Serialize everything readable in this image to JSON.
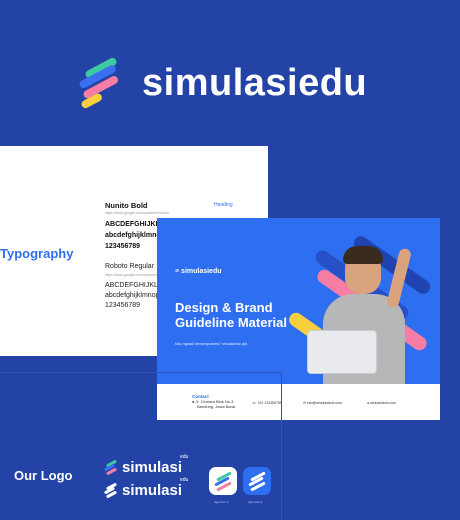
{
  "brand": {
    "name": "simulasiedu",
    "colors": {
      "background": "#2443a6",
      "primary": "#2d6ff0",
      "green": "#3fc9a0",
      "blue": "#3a6ff2",
      "pink": "#f77da4",
      "yellow": "#f7cf3e"
    }
  },
  "typography": {
    "section_title": "Typography",
    "tag": "Heading",
    "font1_name": "Nunito Bold",
    "font1_url": "https://fonts.google.com/specimen/Nunito",
    "font1_upper": "ABCDEFGHIJKLMNOPQRSTUVWXYZ",
    "font1_lower": "abcdefghijklmnopqrstuvwxyz",
    "font1_digits": "123456789",
    "font2_name": "Roboto Regular",
    "font2_url": "https://fonts.google.com/specimen/Roboto",
    "font2_upper": "ABCDEFGHIJKLMNOPQRSTUVWXYZ",
    "font2_lower": "abcdefghijklmnopqrstuvwxyz",
    "font2_digits": "123456789"
  },
  "guideline": {
    "logo_text": "simulasiedu",
    "title_line1": "Design & Brand",
    "title_line2": "Guideline Material",
    "subtitle": "Mau ngasah kemampuanmu? simulasiedu aja!",
    "contact_title": "Contact",
    "address_line1": "Jl. Cemara Blok No.3",
    "address_line2": "Bandung, Jawa Barat",
    "phone": "+62 123456789",
    "email": "info@simulasiedu.com",
    "website": "simulasiedu.com"
  },
  "our_logo": {
    "title": "Our Logo",
    "logo_text": "simulasi",
    "logo_suffix": "edu",
    "app_icon_label_1": "App Icon 1",
    "app_icon_label_2": "App Icon 2"
  }
}
